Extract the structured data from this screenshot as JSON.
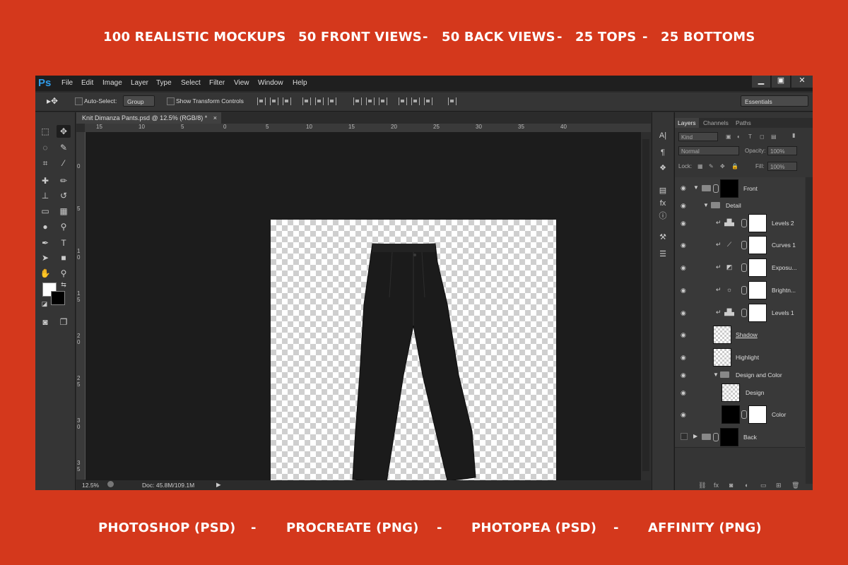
{
  "promo": {
    "top": [
      "100 REALISTIC MOCKUPS",
      "-",
      "50 FRONT VIEWS",
      "-",
      "50 BACK VIEWS",
      "-",
      "25 TOPS",
      "-",
      "25 BOTTOMS"
    ],
    "bottom": [
      "PHOTOSHOP (PSD)",
      "-",
      "PROCREATE (PNG)",
      "-",
      "PHOTOPEA (PSD)",
      "-",
      "AFFINITY (PNG)"
    ]
  },
  "app": {
    "logo": "Ps",
    "menu": [
      "File",
      "Edit",
      "Image",
      "Layer",
      "Type",
      "Select",
      "Filter",
      "View",
      "Window",
      "Help"
    ],
    "window_controls": [
      "▁",
      "▣",
      "✕"
    ]
  },
  "options_bar": {
    "auto_select_label": "Auto-Select:",
    "auto_select_value": "Group",
    "show_transform_label": "Show Transform Controls",
    "workspace": "Essentials"
  },
  "document": {
    "tab_title": "Knit Dimanza Pants.psd @ 12.5% (RGB/8) *",
    "close": "×",
    "ruler_h": [
      "15",
      "10",
      "5",
      "0",
      "5",
      "10",
      "15",
      "20",
      "25",
      "30",
      "35",
      "40"
    ],
    "ruler_v": [
      "0",
      "5",
      "1 0",
      "1 5",
      "2 0",
      "2 5",
      "3 0",
      "3 5"
    ],
    "zoom": "12.5%",
    "doc_size": "Doc: 45.8M/109.1M"
  },
  "layers_panel": {
    "tabs": [
      "Layers",
      "Channels",
      "Paths"
    ],
    "filter_kind": "Kind",
    "blend_mode": "Normal",
    "opacity_label": "Opacity:",
    "opacity_value": "100%",
    "lock_label": "Lock:",
    "fill_label": "Fill:",
    "fill_value": "100%",
    "layers": [
      {
        "name": "Front"
      },
      {
        "name": "Detail"
      },
      {
        "name": "Levels 2"
      },
      {
        "name": "Curves 1"
      },
      {
        "name": "Exposu..."
      },
      {
        "name": "Brightn..."
      },
      {
        "name": "Levels 1"
      },
      {
        "name": "Shadow"
      },
      {
        "name": "Highlight"
      },
      {
        "name": "Design and Color"
      },
      {
        "name": "Design"
      },
      {
        "name": "Color"
      },
      {
        "name": "Back"
      }
    ]
  },
  "colors": {
    "background": "#d4381c",
    "ps_blue": "#2f9cea",
    "foreground_swatch": "#ffffff",
    "background_swatch": "#000000"
  },
  "icons": {
    "eye": "eye-icon",
    "folder": "folder-icon",
    "link": "link-icon",
    "move": "move-tool-icon"
  }
}
